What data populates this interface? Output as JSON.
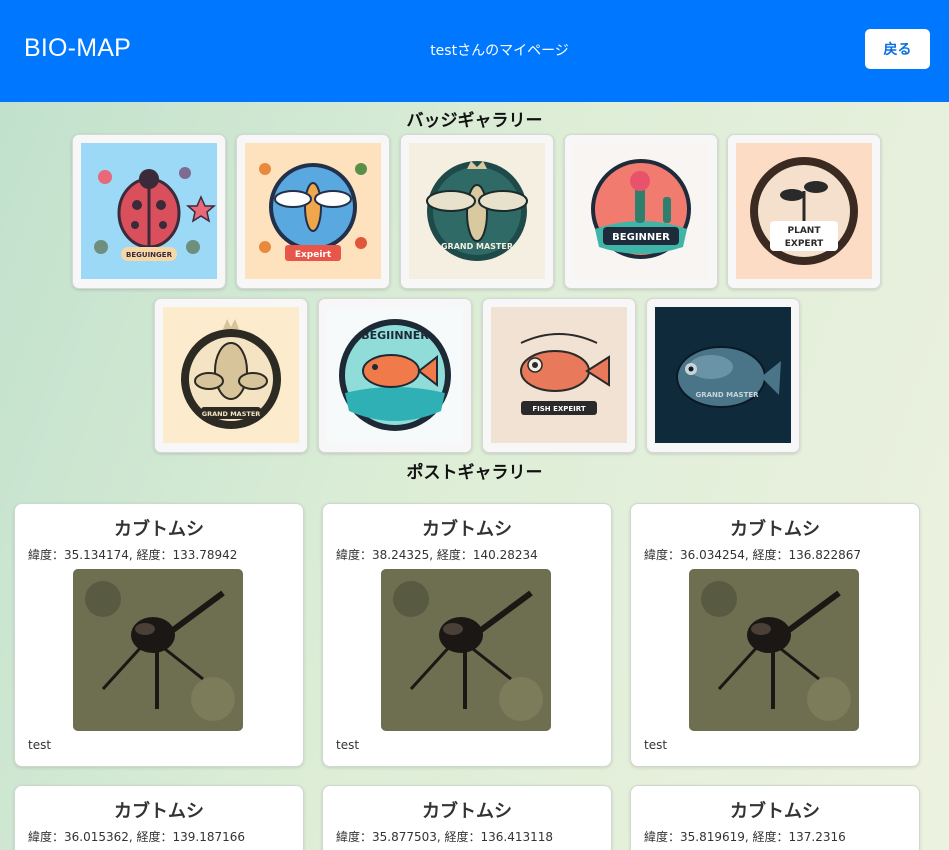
{
  "navbar": {
    "brand": "BIO-MAP",
    "user_page": "testさんのマイページ",
    "back_label": "戻る"
  },
  "badge_gallery": {
    "title": "バッジギャラリー",
    "badges": [
      {
        "icon": "ladybug-beginner-badge",
        "text": "BEGUINGER"
      },
      {
        "icon": "insect-expert-badge",
        "text": "Expeirt"
      },
      {
        "icon": "bee-grand-master-badge",
        "text": "GRAND MASTER"
      },
      {
        "icon": "plant-beginner-badge",
        "text": "BEGINNER"
      },
      {
        "icon": "plant-expert-badge",
        "text": "PLANT EXPERT"
      },
      {
        "icon": "plant-grand-master-badge",
        "text": "GRAND MASTER"
      },
      {
        "icon": "fish-beginner-badge",
        "text": "BEGIINNER"
      },
      {
        "icon": "fish-expert-badge",
        "text": "FISH EXPEIRT"
      },
      {
        "icon": "fish-grand-master-badge",
        "text": "GRAND MASTER"
      }
    ]
  },
  "post_gallery": {
    "title": "ポストギャラリー",
    "posts": [
      {
        "title": "カブトムシ",
        "coords": "緯度：35.134174, 経度：133.78942",
        "comment": "test"
      },
      {
        "title": "カブトムシ",
        "coords": "緯度：38.24325, 経度：140.28234",
        "comment": "test"
      },
      {
        "title": "カブトムシ",
        "coords": "緯度：36.034254, 経度：136.822867",
        "comment": "test"
      },
      {
        "title": "カブトムシ",
        "coords": "緯度：36.015362, 経度：139.187166",
        "comment": ""
      },
      {
        "title": "カブトムシ",
        "coords": "緯度：35.877503, 経度：136.413118",
        "comment": ""
      },
      {
        "title": "カブトムシ",
        "coords": "緯度：35.819619, 経度：137.2316",
        "comment": ""
      }
    ]
  },
  "colors": {
    "navbar": "#0077ff",
    "back_button_text": "#0c6fe0"
  }
}
